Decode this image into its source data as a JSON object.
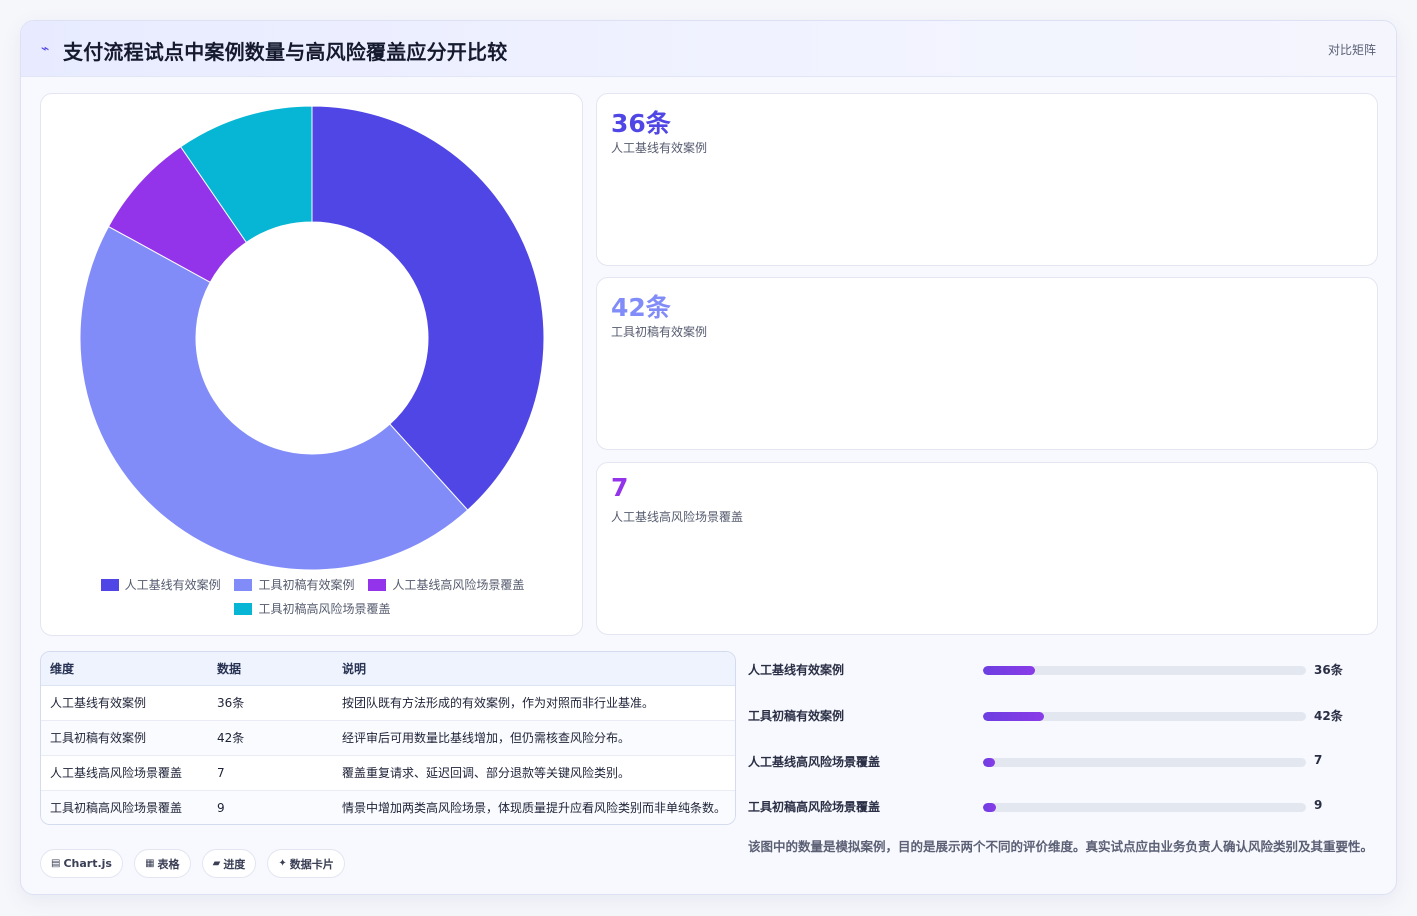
{
  "header": {
    "icon": "sparkline-icon",
    "icon_glyph": "⌁",
    "title": "支付流程试点中案例数量与高风险覆盖应分开比较",
    "right_label": "对比矩阵"
  },
  "chart_data": {
    "type": "pie",
    "variant": "donut",
    "categories": [
      "人工基线有效案例",
      "工具初稿有效案例",
      "人工基线高风险场景覆盖",
      "工具初稿高风险场景覆盖"
    ],
    "values": [
      36,
      42,
      7,
      9
    ],
    "colors": [
      "#4f46e5",
      "#818cf8",
      "#9333ea",
      "#06b6d4"
    ],
    "legend_position": "bottom"
  },
  "stats": [
    {
      "value": "36条",
      "label": "人工基线有效案例",
      "color": "#4f46e5"
    },
    {
      "value": "42条",
      "label": "工具初稿有效案例",
      "color": "#818cf8"
    },
    {
      "value": "7",
      "label": "人工基线高风险场景覆盖",
      "color": "#9333ea"
    }
  ],
  "table": {
    "headers": [
      "维度",
      "数据",
      "说明"
    ],
    "rows": [
      [
        "人工基线有效案例",
        "36条",
        "按团队既有方法形成的有效案例，作为对照而非行业基准。"
      ],
      [
        "工具初稿有效案例",
        "42条",
        "经评审后可用数量比基线增加，但仍需核查风险分布。"
      ],
      [
        "人工基线高风险场景覆盖",
        "7",
        "覆盖重复请求、延迟回调、部分退款等关键风险类别。"
      ],
      [
        "工具初稿高风险场景覆盖",
        "9",
        "情景中增加两类高风险场景，体现质量提升应看风险类别而非单纯条数。"
      ]
    ]
  },
  "progress": [
    {
      "label": "人工基线有效案例",
      "value": "36条",
      "fraction": 0.16
    },
    {
      "label": "工具初稿有效案例",
      "value": "42条",
      "fraction": 0.19
    },
    {
      "label": "人工基线高风险场景覆盖",
      "value": "7",
      "fraction": 0.03
    },
    {
      "label": "工具初稿高风险场景覆盖",
      "value": "9",
      "fraction": 0.04
    }
  ],
  "pills": [
    {
      "icon": "chart-icon",
      "glyph": "▤",
      "label": "Chart.js"
    },
    {
      "icon": "table-icon",
      "glyph": "▦",
      "label": "表格"
    },
    {
      "icon": "progress-icon",
      "glyph": "▰",
      "label": "进度"
    },
    {
      "icon": "card-icon",
      "glyph": "✦",
      "label": "数据卡片"
    }
  ],
  "note": "该图中的数量是模拟案例，目的是展示两个不同的评价维度。真实试点应由业务负责人确认风险类别及其重要性。"
}
